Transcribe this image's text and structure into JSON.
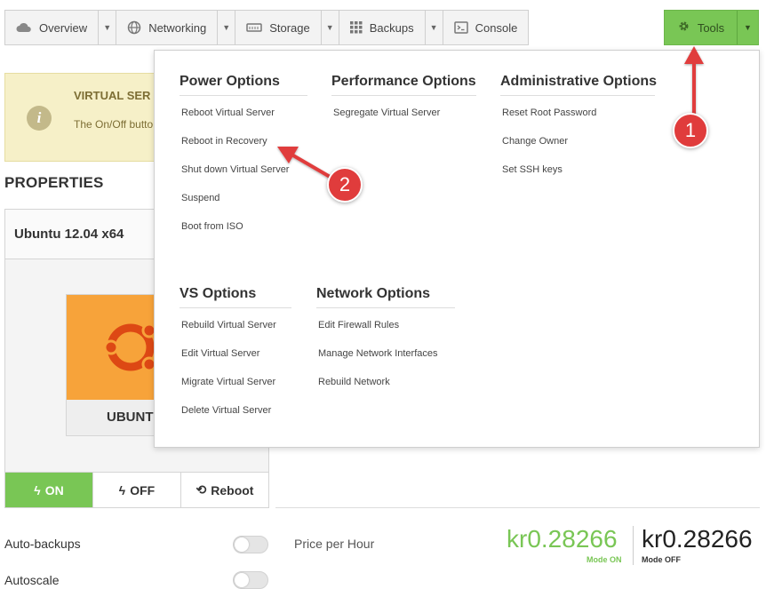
{
  "nav": {
    "items": [
      {
        "label": "Overview",
        "icon": "cloud-icon"
      },
      {
        "label": "Networking",
        "icon": "globe-icon"
      },
      {
        "label": "Storage",
        "icon": "storage-icon"
      },
      {
        "label": "Backups",
        "icon": "grid-icon"
      },
      {
        "label": "Console",
        "icon": "console-icon"
      }
    ],
    "tools_label": "Tools"
  },
  "notice": {
    "title": "VIRTUAL SER",
    "text": "The On/Off butto transactions and"
  },
  "properties": {
    "title": "PROPERTIES",
    "os_name": "Ubuntu 12.04 x64",
    "os_logo_label": "UBUNT"
  },
  "power": {
    "on_label": "ON",
    "off_label": "OFF",
    "reboot_label": "Reboot"
  },
  "settings": {
    "auto_backups_label": "Auto-backups",
    "autoscale_label": "Autoscale",
    "price_label": "Price per Hour",
    "price_on": "kr0.28266",
    "price_off": "kr0.28266",
    "mode_on": "Mode ON",
    "mode_off": "Mode OFF"
  },
  "menu": {
    "power": {
      "title": "Power Options",
      "items": [
        "Reboot Virtual Server",
        "Reboot in Recovery",
        "Shut down Virtual Server",
        "Suspend",
        "Boot from ISO"
      ]
    },
    "performance": {
      "title": "Performance Options",
      "items": [
        "Segregate Virtual Server"
      ]
    },
    "admin": {
      "title": "Administrative Options",
      "items": [
        "Reset Root Password",
        "Change Owner",
        "Set SSH keys"
      ]
    },
    "vs": {
      "title": "VS Options",
      "items": [
        "Rebuild Virtual Server",
        "Edit Virtual Server",
        "Migrate Virtual Server",
        "Delete Virtual Server"
      ]
    },
    "network": {
      "title": "Network Options",
      "items": [
        "Edit Firewall Rules",
        "Manage Network Interfaces",
        "Rebuild Network"
      ]
    }
  },
  "annotations": {
    "badge_1": "1",
    "badge_2": "2"
  },
  "colors": {
    "accent_green": "#79c655",
    "annotation_red": "#e03c3c",
    "notice_bg": "#f6f0c8",
    "ubuntu_orange": "#f7a33a"
  }
}
